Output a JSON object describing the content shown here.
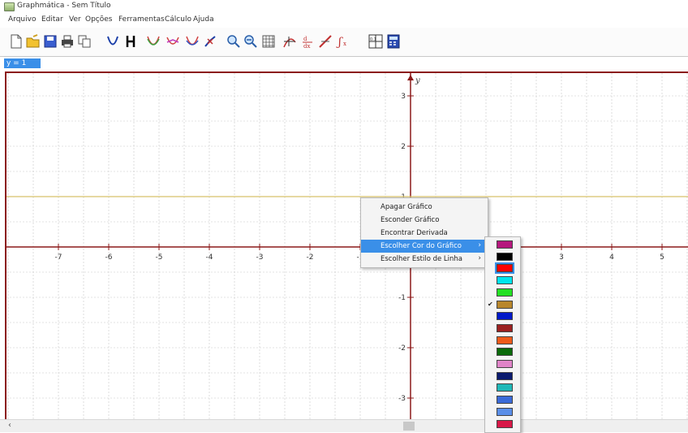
{
  "window": {
    "title": "Graphmática - Sem Título"
  },
  "menu": [
    "Arquivo",
    "Editar",
    "Ver",
    "Opções",
    "Ferramentas",
    "Cálculo",
    "Ajuda"
  ],
  "toolbar": {
    "icons": [
      "new-file-icon",
      "open-folder-icon",
      "save-icon",
      "print-icon",
      "copy-icon",
      "parabola-icon",
      "bracket-icon",
      "graph-curves-icon",
      "graph-curves-2-icon",
      "graph-curves-3-icon",
      "point-icon",
      "zoom-in-icon",
      "zoom-out-icon",
      "grid-icon",
      "tangent-icon",
      "derivative-icon",
      "slope-icon",
      "integral-icon",
      "table-icon",
      "calculator-icon"
    ]
  },
  "equation": {
    "value": "y = 1"
  },
  "graph": {
    "y_axis_label": "y",
    "x_ticks": [
      "-7",
      "-6",
      "-5",
      "-4",
      "-3",
      "-2",
      "-1",
      "1",
      "2",
      "3",
      "4",
      "5"
    ],
    "y_ticks": [
      "3",
      "2",
      "1",
      "-1",
      "-2",
      "-3"
    ],
    "plotted_function": "y = 1",
    "curve_color": "#d8c26a",
    "axis_color": "#8b1a1a"
  },
  "context_menu": {
    "items": [
      {
        "label": "Apagar Gráfico",
        "submenu": false
      },
      {
        "label": "Esconder Gráfico",
        "submenu": false
      },
      {
        "label": "Encontrar Derivada",
        "submenu": false
      },
      {
        "label": "Escolher Cor do Gráfico",
        "submenu": true,
        "selected": true
      },
      {
        "label": "Escolher Estilo de Linha",
        "submenu": true
      }
    ],
    "submenu_arrow": "›"
  },
  "color_submenu": {
    "colors": [
      "#b5177d",
      "#000000",
      "#ff0000",
      "#00e5ee",
      "#22e022",
      "#b8862b",
      "#0018c8",
      "#9b2020",
      "#ee5a1a",
      "#0a6a0a",
      "#e084c8",
      "#0a1a6e",
      "#20b8b8",
      "#3a6ad8",
      "#5a8ee8",
      "#d81848"
    ],
    "highlighted_index": 2,
    "checked_index": 5,
    "check_mark": "✔"
  }
}
